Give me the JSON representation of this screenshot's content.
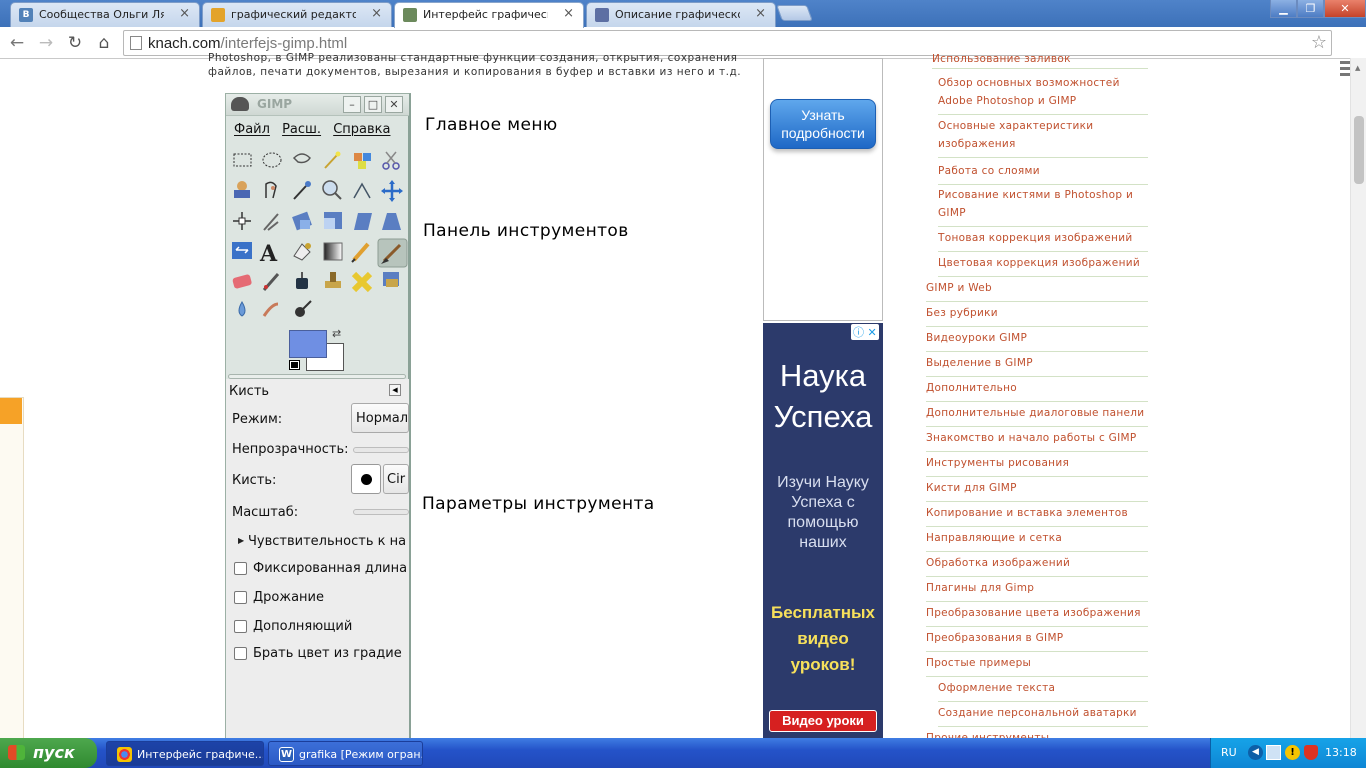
{
  "browser": {
    "tabs": [
      {
        "label": "Сообщества Ольги Лямкин",
        "favicon": "vk-icon",
        "color": "#5181b8"
      },
      {
        "label": "графический редактор gim",
        "favicon": "search-icon",
        "color": "#e3a32a"
      },
      {
        "label": "Интерфейс графического р",
        "favicon": "gimp-icon",
        "color": "#6c8a5c"
      },
      {
        "label": "Описание графического ре",
        "favicon": "gimp-icon",
        "color": "#5d6fa3"
      }
    ],
    "url_host": "knach.com",
    "url_path": "/interfejs-gimp.html"
  },
  "page": {
    "intro_line1": "Photoshop, в GIMP реализованы стандартные функции создания, открытия, сохранения",
    "intro_line2": "файлов, печати документов, вырезания и копирования в буфер и вставки из него и т.д.",
    "annotations": {
      "main_menu": "Главное меню",
      "toolbox": "Панель инструментов",
      "tool_options": "Параметры инструмента"
    }
  },
  "gimp": {
    "title": "GIMP",
    "menu": [
      "Файл",
      "Расш.",
      "Справка"
    ],
    "fg_color": "#6f8fe3",
    "bg_color": "#ffffff",
    "tool_name": "Кисть",
    "mode_label": "Режим:",
    "mode_value": "Нормал",
    "opacity_label": "Непрозрачность:",
    "brush_label": "Кисть:",
    "brush_value": "Cir",
    "scale_label": "Масштаб:",
    "sensitivity": "Чувствительность к на",
    "checkboxes": [
      "Фиксированная длина",
      "Дрожание",
      "Дополняющий",
      "Брать цвет из градие"
    ]
  },
  "ads": {
    "ad1_button": "Узнать подробности",
    "ad2_title1": "Наука",
    "ad2_title2": "Успеха",
    "ad2_text": "Изучи Науку Успеха с помощью наших",
    "ad2_highlight": "Бесплатных видео уроков!",
    "ad2_button": "Видео уроки"
  },
  "sidebar": {
    "top_cut": "Использование заливок",
    "items": [
      {
        "label": "Обзор основных возможностей Adobe Photoshop и GIMP",
        "sub": true
      },
      {
        "label": "Основные характеристики изображения",
        "sub": true
      },
      {
        "label": "Работа со слоями",
        "sub": true
      },
      {
        "label": "Рисование кистями в Photoshop и GIMP",
        "sub": true
      },
      {
        "label": "Тоновая коррекция изображений",
        "sub": true
      },
      {
        "label": "Цветовая коррекция изображений",
        "sub": true
      },
      {
        "label": "GIMP и Web",
        "sub": false
      },
      {
        "label": "Без рубрики",
        "sub": false
      },
      {
        "label": "Видеоуроки GIMP",
        "sub": false
      },
      {
        "label": "Выделение в GIMP",
        "sub": false
      },
      {
        "label": "Дополнительно",
        "sub": false
      },
      {
        "label": "Дополнительные диалоговые панели",
        "sub": false
      },
      {
        "label": "Знакомство и начало работы с GIMP",
        "sub": false
      },
      {
        "label": "Инструменты рисования",
        "sub": false
      },
      {
        "label": "Кисти для GIMP",
        "sub": false
      },
      {
        "label": "Копирование и вставка элементов",
        "sub": false
      },
      {
        "label": "Направляющие и сетка",
        "sub": false
      },
      {
        "label": "Обработка изображений",
        "sub": false
      },
      {
        "label": "Плагины для Gimp",
        "sub": false
      },
      {
        "label": "Преобразование цвета изображения",
        "sub": false
      },
      {
        "label": "Преобразования в GIMP",
        "sub": false
      },
      {
        "label": "Простые примеры",
        "sub": false
      },
      {
        "label": "Оформление текста",
        "sub": true
      },
      {
        "label": "Создание персональной аватарки",
        "sub": true
      },
      {
        "label": "Прочие инструменты",
        "sub": false
      }
    ]
  },
  "taskbar": {
    "start": "пуск",
    "tasks": [
      "Интерфейс графиче...",
      "grafika [Режим огран..."
    ],
    "lang": "RU",
    "time": "13:18"
  }
}
